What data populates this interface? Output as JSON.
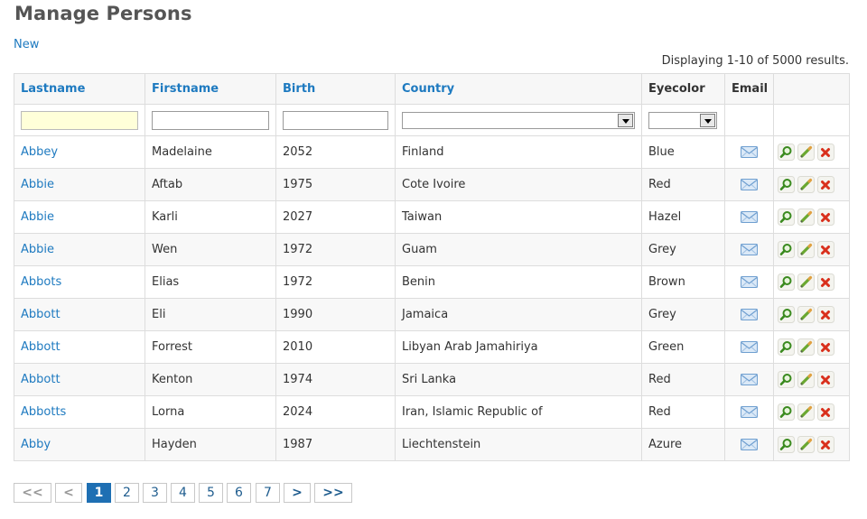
{
  "page": {
    "title": "Manage Persons",
    "new_link": "New",
    "summary": "Displaying 1-10 of 5000 results."
  },
  "table": {
    "headers": {
      "lastname": "Lastname",
      "firstname": "Firstname",
      "birth": "Birth",
      "country": "Country",
      "eyecolor": "Eyecolor",
      "email": "Email"
    },
    "filters": {
      "lastname": "",
      "firstname": "",
      "birth": "",
      "country": "",
      "eyecolor": ""
    },
    "rows": [
      {
        "lastname": "Abbey",
        "firstname": "Madelaine",
        "birth": "2052",
        "country": "Finland",
        "eyecolor": "Blue"
      },
      {
        "lastname": "Abbie",
        "firstname": "Aftab",
        "birth": "1975",
        "country": "Cote Ivoire",
        "eyecolor": "Red"
      },
      {
        "lastname": "Abbie",
        "firstname": "Karli",
        "birth": "2027",
        "country": "Taiwan",
        "eyecolor": "Hazel"
      },
      {
        "lastname": "Abbie",
        "firstname": "Wen",
        "birth": "1972",
        "country": "Guam",
        "eyecolor": "Grey"
      },
      {
        "lastname": "Abbots",
        "firstname": "Elias",
        "birth": "1972",
        "country": "Benin",
        "eyecolor": "Brown"
      },
      {
        "lastname": "Abbott",
        "firstname": "Eli",
        "birth": "1990",
        "country": "Jamaica",
        "eyecolor": "Grey"
      },
      {
        "lastname": "Abbott",
        "firstname": "Forrest",
        "birth": "2010",
        "country": "Libyan Arab Jamahiriya",
        "eyecolor": "Green"
      },
      {
        "lastname": "Abbott",
        "firstname": "Kenton",
        "birth": "1974",
        "country": "Sri Lanka",
        "eyecolor": "Red"
      },
      {
        "lastname": "Abbotts",
        "firstname": "Lorna",
        "birth": "2024",
        "country": "Iran, Islamic Republic of",
        "eyecolor": "Red"
      },
      {
        "lastname": "Abby",
        "firstname": "Hayden",
        "birth": "1987",
        "country": "Liechtenstein",
        "eyecolor": "Azure"
      }
    ],
    "row_icons": {
      "email": "envelope-icon",
      "view": "magnifier-icon",
      "edit": "pencil-icon",
      "delete": "red-x-icon"
    }
  },
  "pager": {
    "first": "<<",
    "prev": "<",
    "pages": [
      "1",
      "2",
      "3",
      "4",
      "5",
      "6",
      "7"
    ],
    "current": "1",
    "next": ">",
    "last": ">>"
  },
  "colors": {
    "link": "#1e7ac0",
    "title": "#555555",
    "current_page_bg": "#1e6fb3",
    "active_filter_bg": "#ffffd9",
    "delete_red": "#d9301c",
    "view_green": "#3a8a1e"
  }
}
